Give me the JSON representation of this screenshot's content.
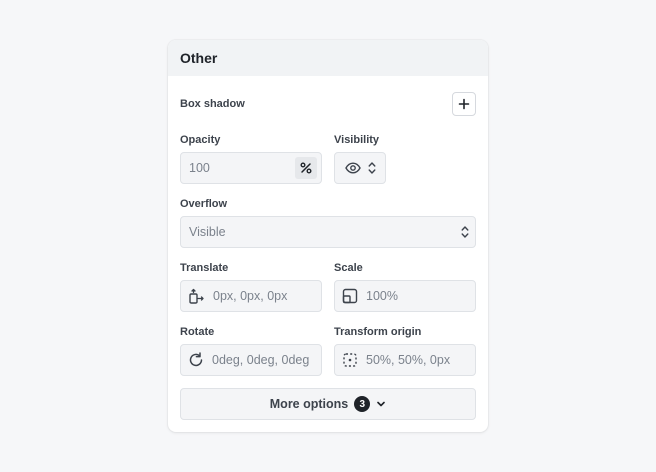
{
  "panel": {
    "title": "Other",
    "box_shadow": {
      "label": "Box shadow",
      "add_icon": "plus-icon"
    },
    "opacity": {
      "label": "Opacity",
      "value": "100",
      "unit_icon": "percent-icon"
    },
    "visibility": {
      "label": "Visibility",
      "icon": "eye-icon",
      "stepper_icon": "chevron-up-down-icon"
    },
    "overflow": {
      "label": "Overflow",
      "value": "Visible",
      "stepper_icon": "chevron-up-down-icon"
    },
    "translate": {
      "label": "Translate",
      "value": "0px, 0px, 0px",
      "icon": "translate-icon"
    },
    "scale": {
      "label": "Scale",
      "value": "100%",
      "icon": "scale-icon"
    },
    "rotate": {
      "label": "Rotate",
      "value": "0deg, 0deg, 0deg",
      "icon": "rotate-icon"
    },
    "transform_origin": {
      "label": "Transform origin",
      "value": "50%, 50%, 0px",
      "icon": "transform-origin-icon"
    },
    "more_options": {
      "label": "More options",
      "count": "3",
      "icon": "chevron-down-icon"
    }
  },
  "colors": {
    "background": "#f6f7f9",
    "panel_header": "#f1f3f5",
    "field_bg": "#f4f5f7",
    "field_border": "#dfe2e6",
    "text_primary": "#1f2329",
    "text_muted": "#7b828c"
  }
}
